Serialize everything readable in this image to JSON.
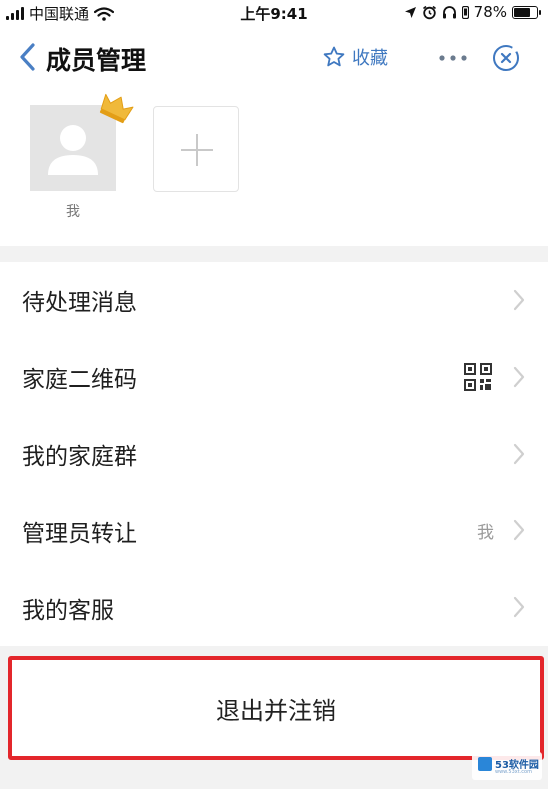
{
  "status_bar": {
    "carrier": "中国联通",
    "time": "上午9:41",
    "battery": "78%",
    "battery_level": 0.78
  },
  "header": {
    "title": "成员管理",
    "favorite_label": "收藏",
    "accent_color": "#3f78c0"
  },
  "members": [
    {
      "name": "我",
      "is_admin": true
    }
  ],
  "menu": {
    "items": [
      {
        "label": "待处理消息",
        "value": ""
      },
      {
        "label": "家庭二维码",
        "value": ""
      },
      {
        "label": "我的家庭群",
        "value": ""
      },
      {
        "label": "管理员转让",
        "value": "我"
      },
      {
        "label": "我的客服",
        "value": ""
      }
    ]
  },
  "logout": {
    "label": "退出并注销",
    "highlight_color": "#e3262b"
  },
  "watermark": {
    "text": "53软件园",
    "sub": "www.53xt.com"
  }
}
